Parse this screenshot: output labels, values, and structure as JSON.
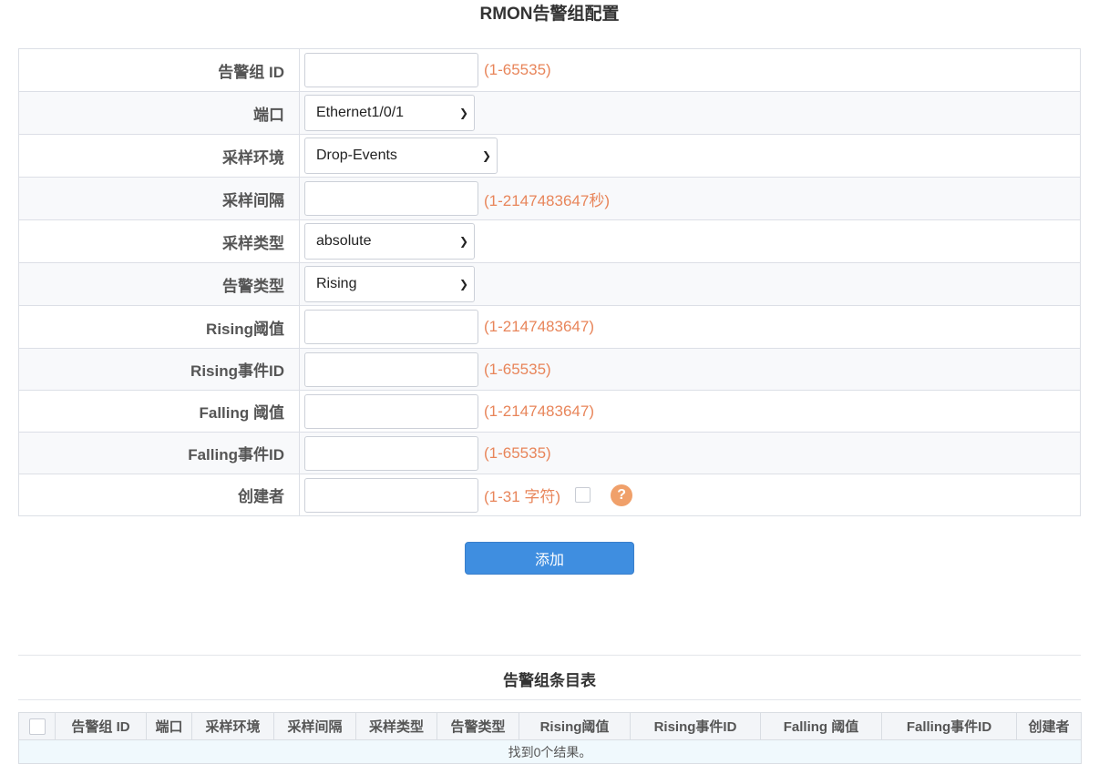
{
  "page_title": "RMON告警组配置",
  "form": {
    "rows": [
      {
        "label": "告警组 ID",
        "type": "input",
        "value": "",
        "hint": "(1-65535)"
      },
      {
        "label": "端口",
        "type": "select",
        "value": "Ethernet1/0/1"
      },
      {
        "label": "采样环境",
        "type": "select",
        "value": "Drop-Events"
      },
      {
        "label": "采样间隔",
        "type": "input",
        "value": "",
        "hint": "(1-2147483647秒)"
      },
      {
        "label": "采样类型",
        "type": "select",
        "value": "absolute"
      },
      {
        "label": "告警类型",
        "type": "select",
        "value": "Rising"
      },
      {
        "label": "Rising阈值",
        "type": "input",
        "value": "",
        "hint": "(1-2147483647)"
      },
      {
        "label": "Rising事件ID",
        "type": "input",
        "value": "",
        "hint": "(1-65535)"
      },
      {
        "label": "Falling 阈值",
        "type": "input",
        "value": "",
        "hint": "(1-2147483647)"
      },
      {
        "label": "Falling事件ID",
        "type": "input",
        "value": "",
        "hint": "(1-65535)"
      },
      {
        "label": "创建者",
        "type": "input",
        "value": "",
        "hint": "(1-31 字符)",
        "help_icon": "?"
      }
    ]
  },
  "add_button_label": "添加",
  "list": {
    "title": "告警组条目表",
    "columns": [
      "告警组 ID",
      "端口",
      "采样环境",
      "采样间隔",
      "采样类型",
      "告警类型",
      "Rising阈值",
      "Rising事件ID",
      "Falling 阈值",
      "Falling事件ID",
      "创建者"
    ],
    "empty_text": "找到0个结果。"
  },
  "colors": {
    "hint": "#e8855a",
    "button": "#3f8ee0",
    "help_icon": "#f0a06a"
  },
  "icons": {
    "select_arrow": "chevron-down-icon",
    "help": "help-icon"
  }
}
